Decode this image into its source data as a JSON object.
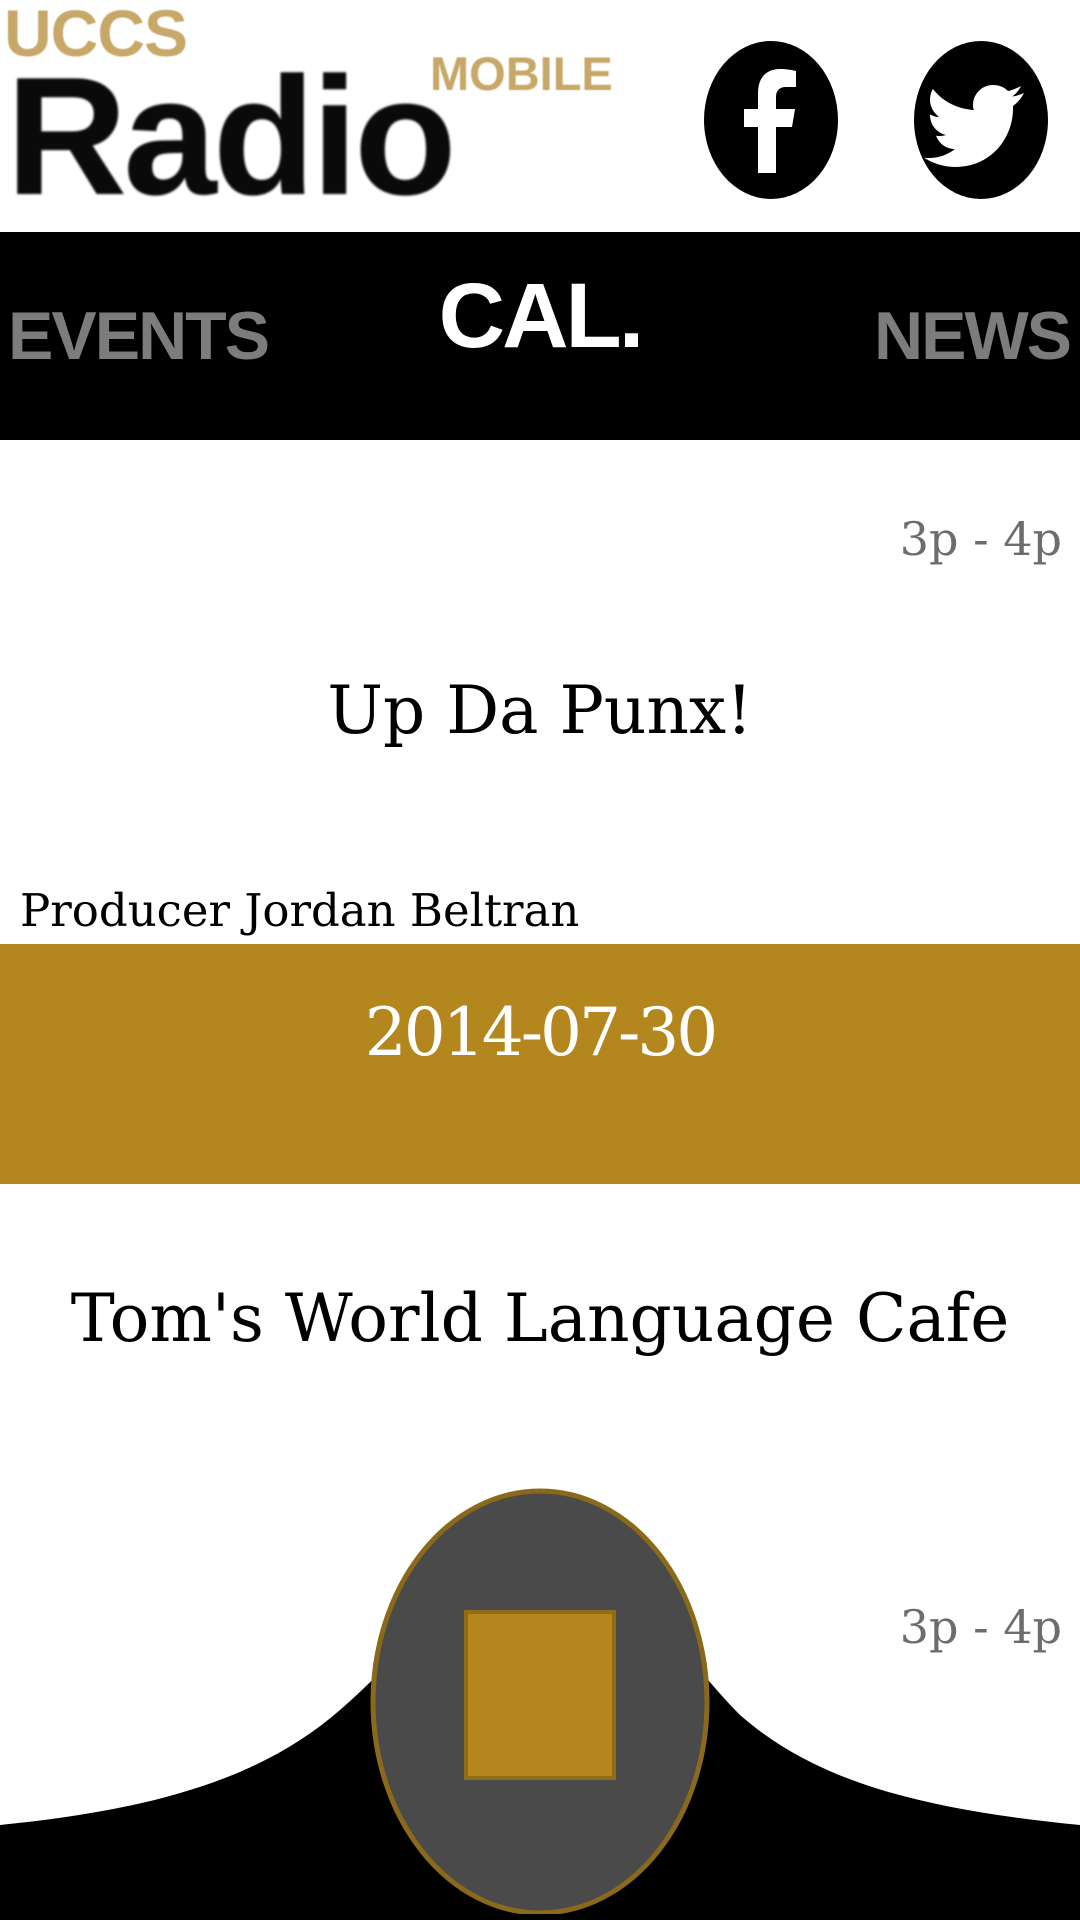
{
  "header": {
    "logo": {
      "uccs": "UCCS",
      "mobile": "MOBILE",
      "radio": "Radio"
    },
    "social": [
      {
        "icon": "facebook-icon",
        "label": "f"
      },
      {
        "icon": "twitter-icon"
      }
    ]
  },
  "nav": {
    "tabs": [
      {
        "label": "EVENTS",
        "active": false
      },
      {
        "label": "CAL.",
        "active": true
      },
      {
        "label": "NEWS",
        "active": false
      }
    ]
  },
  "schedule": {
    "items": [
      {
        "time": "3p - 4p",
        "title": "Up Da Punx!",
        "producer": "Producer Jordan Beltran"
      }
    ],
    "date_banner": "2014-07-30",
    "next_items": [
      {
        "title": "Tom's World Language Cafe",
        "time": "3p - 4p"
      }
    ]
  },
  "player": {
    "button_icon": "stop-icon",
    "state": "playing"
  },
  "colors": {
    "accent_gold": "#b3871d",
    "logo_gold": "#c7a868",
    "nav_bg": "#000000",
    "nav_inactive": "#7c7c7c",
    "player_disc": "#4a4a4a"
  }
}
